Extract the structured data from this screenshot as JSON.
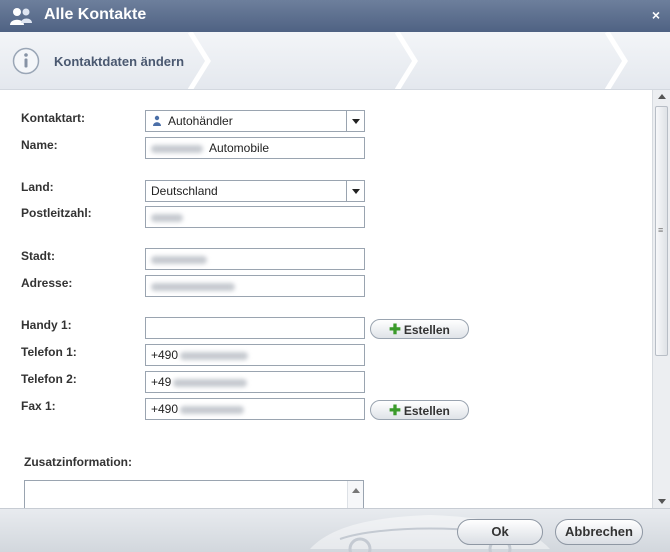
{
  "window": {
    "title": "Alle Kontakte",
    "close_symbol": "×",
    "app_icon": "contacts-icon"
  },
  "step": {
    "label": "Kontaktdaten ändern",
    "icon": "info-icon"
  },
  "colors": {
    "titlebar": "#5a6c8c",
    "plus": "#3a9a2a",
    "border": "#9aa4b0"
  },
  "form": {
    "kontaktart": {
      "label": "Kontaktart:",
      "value": "Autohändler",
      "icon": "person-tree-icon"
    },
    "name": {
      "label": "Name:",
      "value": "Automobile"
    },
    "land": {
      "label": "Land:",
      "value": "Deutschland"
    },
    "plz": {
      "label": "Postleitzahl:",
      "value": ""
    },
    "stadt": {
      "label": "Stadt:",
      "value": ""
    },
    "adresse": {
      "label": "Adresse:",
      "value": ""
    },
    "handy1": {
      "label": "Handy 1:",
      "value": ""
    },
    "telefon1": {
      "label": "Telefon 1:",
      "value": "+490"
    },
    "telefon2": {
      "label": "Telefon 2:",
      "value": "+49"
    },
    "fax1": {
      "label": "Fax 1:",
      "value": "+490"
    },
    "zusatz": {
      "label": "Zusatzinformation:",
      "value": ""
    },
    "estellen_label": "Estellen",
    "plus_symbol": "✚"
  },
  "footer": {
    "ok_label": "Ok",
    "cancel_label": "Abbrechen"
  }
}
